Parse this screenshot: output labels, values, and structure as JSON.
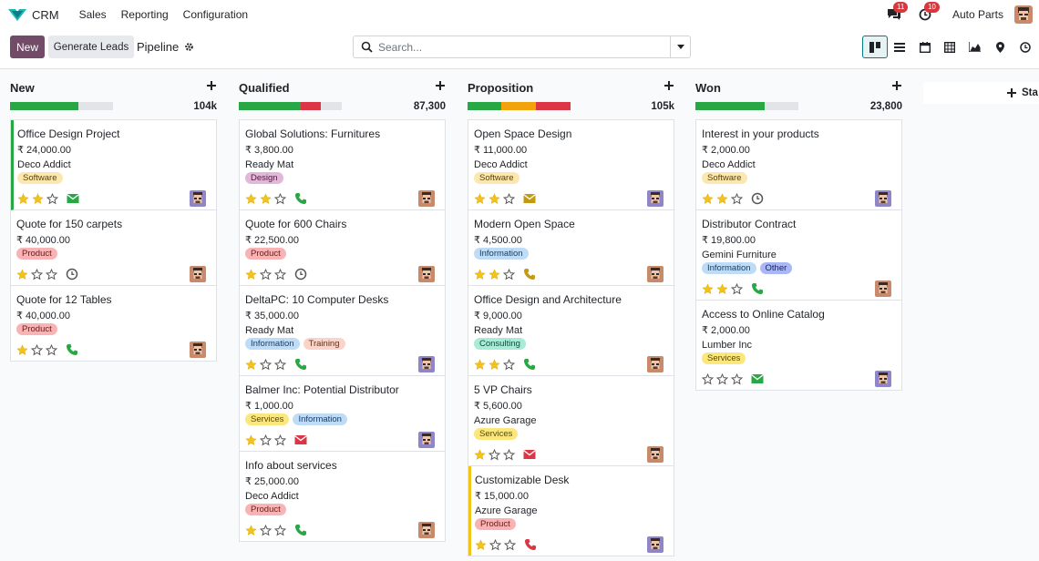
{
  "nav": {
    "app_name": "CRM",
    "menu": [
      "Sales",
      "Reporting",
      "Configuration"
    ],
    "messages_badge": "11",
    "activities_badge": "10",
    "company": "Auto Parts"
  },
  "control": {
    "new_label": "New",
    "generate_leads_label": "Generate Leads",
    "breadcrumb": "Pipeline",
    "search_placeholder": "Search..."
  },
  "views": [
    "kanban",
    "list",
    "calendar",
    "pivot",
    "graph",
    "map",
    "activity"
  ],
  "add_stage_label": "Sta",
  "colors": {
    "brand": "#714b67",
    "accent": "#017e84",
    "won": "#28a745",
    "planned": "#f0a30a",
    "overdue": "#dc3545"
  },
  "columns": [
    {
      "title": "New",
      "total": "104k",
      "progress": [
        {
          "color": "#28a745",
          "pct": 66
        },
        {
          "color": "#e2e4e8",
          "pct": 34
        }
      ],
      "cards": [
        {
          "title": "Office Design Project",
          "amount": "₹ 24,000.00",
          "partner": "Deco Addict",
          "tags": [
            {
              "label": "Software",
              "bg": "#fde7b0",
              "fg": "#5c4300"
            }
          ],
          "stars": 2,
          "activity": "email",
          "activity_color": "#28a745",
          "accent": "green"
        },
        {
          "title": "Quote for 150 carpets",
          "amount": "₹ 40,000.00",
          "partner": "",
          "tags": [
            {
              "label": "Product",
              "bg": "#f8b4b4",
              "fg": "#6b1a1a"
            }
          ],
          "stars": 1,
          "activity": "clock",
          "activity_color": "#555555",
          "accent": ""
        },
        {
          "title": "Quote for 12 Tables",
          "amount": "₹ 40,000.00",
          "partner": "",
          "tags": [
            {
              "label": "Product",
              "bg": "#f8b4b4",
              "fg": "#6b1a1a"
            }
          ],
          "stars": 1,
          "activity": "phone",
          "activity_color": "#28a745",
          "accent": ""
        }
      ]
    },
    {
      "title": "Qualified",
      "total": "87,300",
      "progress": [
        {
          "color": "#28a745",
          "pct": 60
        },
        {
          "color": "#dc3545",
          "pct": 20
        },
        {
          "color": "#e2e4e8",
          "pct": 20
        }
      ],
      "cards": [
        {
          "title": "Global Solutions: Furnitures",
          "amount": "₹ 3,800.00",
          "partner": "Ready Mat",
          "tags": [
            {
              "label": "Design",
              "bg": "#e3b7d8",
              "fg": "#4d1a40"
            }
          ],
          "stars": 2,
          "activity": "phone",
          "activity_color": "#28a745",
          "accent": ""
        },
        {
          "title": "Quote for 600 Chairs",
          "amount": "₹ 22,500.00",
          "partner": "",
          "tags": [
            {
              "label": "Product",
              "bg": "#f8b4b4",
              "fg": "#6b1a1a"
            }
          ],
          "stars": 1,
          "activity": "clock",
          "activity_color": "#555555",
          "accent": ""
        },
        {
          "title": "DeltaPC: 10 Computer Desks",
          "amount": "₹ 35,000.00",
          "partner": "Ready Mat",
          "tags": [
            {
              "label": "Information",
              "bg": "#bfdcf7",
              "fg": "#1a3d66"
            },
            {
              "label": "Training",
              "bg": "#fad4c8",
              "fg": "#6b2e1a"
            }
          ],
          "stars": 1,
          "activity": "phone",
          "activity_color": "#28a745",
          "accent": ""
        },
        {
          "title": "Balmer Inc: Potential Distributor",
          "amount": "₹ 1,000.00",
          "partner": "",
          "tags": [
            {
              "label": "Services",
              "bg": "#fbe77c",
              "fg": "#5c4d00"
            },
            {
              "label": "Information",
              "bg": "#bfdcf7",
              "fg": "#1a3d66"
            }
          ],
          "stars": 1,
          "activity": "email",
          "activity_color": "#dc3545",
          "accent": ""
        },
        {
          "title": "Info about services",
          "amount": "₹ 25,000.00",
          "partner": "Deco Addict",
          "tags": [
            {
              "label": "Product",
              "bg": "#f8b4b4",
              "fg": "#6b1a1a"
            }
          ],
          "stars": 1,
          "activity": "phone",
          "activity_color": "#28a745",
          "accent": ""
        }
      ]
    },
    {
      "title": "Proposition",
      "total": "105k",
      "progress": [
        {
          "color": "#28a745",
          "pct": 33
        },
        {
          "color": "#f0a30a",
          "pct": 33
        },
        {
          "color": "#dc3545",
          "pct": 34
        }
      ],
      "cards": [
        {
          "title": "Open Space Design",
          "amount": "₹ 11,000.00",
          "partner": "Deco Addict",
          "tags": [
            {
              "label": "Software",
              "bg": "#fde7b0",
              "fg": "#5c4300"
            }
          ],
          "stars": 2,
          "activity": "email",
          "activity_color": "#c49a10",
          "accent": ""
        },
        {
          "title": "Modern Open Space",
          "amount": "₹ 4,500.00",
          "partner": "",
          "tags": [
            {
              "label": "Information",
              "bg": "#bfdcf7",
              "fg": "#1a3d66"
            }
          ],
          "stars": 2,
          "activity": "phone",
          "activity_color": "#c49a10",
          "accent": ""
        },
        {
          "title": "Office Design and Architecture",
          "amount": "₹ 9,000.00",
          "partner": "Ready Mat",
          "tags": [
            {
              "label": "Consulting",
              "bg": "#a8ebd6",
              "fg": "#0f4d3b"
            }
          ],
          "stars": 2,
          "activity": "phone",
          "activity_color": "#28a745",
          "accent": ""
        },
        {
          "title": "5 VP Chairs",
          "amount": "₹ 5,600.00",
          "partner": "Azure Garage",
          "tags": [
            {
              "label": "Services",
              "bg": "#fbe77c",
              "fg": "#5c4d00"
            }
          ],
          "stars": 1,
          "activity": "email",
          "activity_color": "#dc3545",
          "accent": ""
        },
        {
          "title": "Customizable Desk",
          "amount": "₹ 15,000.00",
          "partner": "Azure Garage",
          "tags": [
            {
              "label": "Product",
              "bg": "#f8b4b4",
              "fg": "#6b1a1a"
            }
          ],
          "stars": 1,
          "activity": "phone",
          "activity_color": "#dc3545",
          "accent": "yellow"
        }
      ]
    },
    {
      "title": "Won",
      "total": "23,800",
      "progress": [
        {
          "color": "#28a745",
          "pct": 67
        },
        {
          "color": "#e2e4e8",
          "pct": 33
        }
      ],
      "cards": [
        {
          "title": "Interest in your products",
          "amount": "₹ 2,000.00",
          "partner": "Deco Addict",
          "tags": [
            {
              "label": "Software",
              "bg": "#fde7b0",
              "fg": "#5c4300"
            }
          ],
          "stars": 2,
          "activity": "clock",
          "activity_color": "#555555",
          "accent": ""
        },
        {
          "title": "Distributor Contract",
          "amount": "₹ 19,800.00",
          "partner": "Gemini Furniture",
          "tags": [
            {
              "label": "Information",
              "bg": "#bfdcf7",
              "fg": "#1a3d66"
            },
            {
              "label": "Other",
              "bg": "#a9b7f5",
              "fg": "#1a2466"
            }
          ],
          "stars": 2,
          "activity": "phone",
          "activity_color": "#28a745",
          "accent": ""
        },
        {
          "title": "Access to Online Catalog",
          "amount": "₹ 2,000.00",
          "partner": "Lumber Inc",
          "tags": [
            {
              "label": "Services",
              "bg": "#fbe77c",
              "fg": "#5c4d00"
            }
          ],
          "stars": 0,
          "activity": "email",
          "activity_color": "#28a745",
          "accent": ""
        }
      ]
    }
  ]
}
